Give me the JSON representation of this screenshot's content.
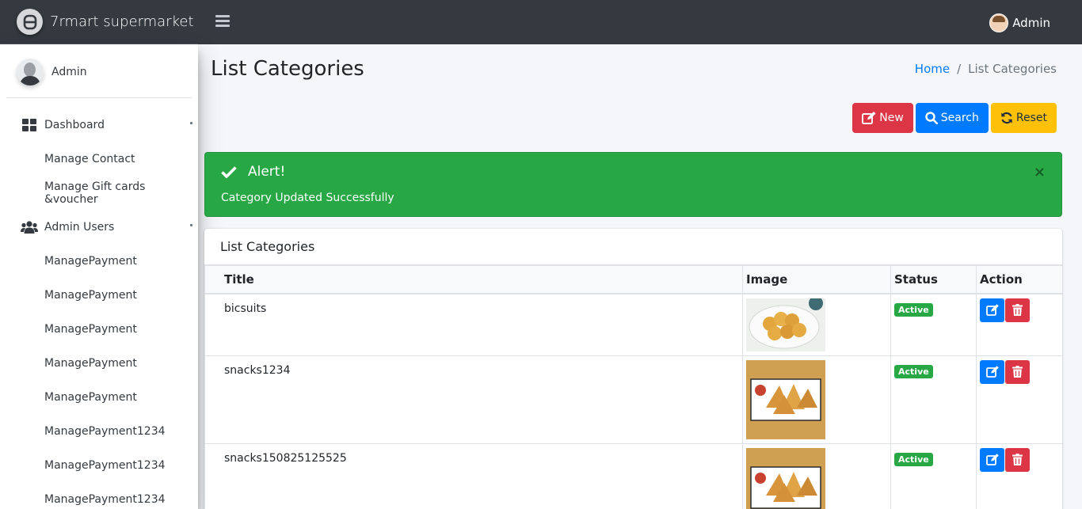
{
  "app": {
    "brand": "7rmart supermarket"
  },
  "topbar": {
    "user_name": "Admin"
  },
  "sidebar": {
    "user_name": "Admin",
    "items": [
      {
        "label": "Dashboard",
        "icon": "dashboard-grid-icon",
        "type": "parent"
      },
      {
        "label": "Manage Contact",
        "type": "child"
      },
      {
        "label": "Manage Gift cards &voucher",
        "type": "child"
      },
      {
        "label": "Admin Users",
        "icon": "users-icon",
        "type": "parent"
      },
      {
        "label": "ManagePayment",
        "type": "child"
      },
      {
        "label": "ManagePayment",
        "type": "child"
      },
      {
        "label": "ManagePayment",
        "type": "child"
      },
      {
        "label": "ManagePayment",
        "type": "child"
      },
      {
        "label": "ManagePayment",
        "type": "child"
      },
      {
        "label": "ManagePayment1234",
        "type": "child"
      },
      {
        "label": "ManagePayment1234",
        "type": "child"
      },
      {
        "label": "ManagePayment1234",
        "type": "child"
      }
    ]
  },
  "page": {
    "title": "List Categories",
    "breadcrumb": {
      "home": "Home",
      "current": "List Categories"
    }
  },
  "toolbar": {
    "new_label": "New",
    "search_label": "Search",
    "reset_label": "Reset"
  },
  "alert": {
    "title": "Alert!",
    "message": "Category Updated Successfully",
    "close": "×"
  },
  "table": {
    "card_title": "List Categories",
    "columns": [
      "Title",
      "Image",
      "Status",
      "Action"
    ],
    "rows": [
      {
        "title": "bicsuits",
        "image": "biscuits-plate",
        "status": "Active"
      },
      {
        "title": "snacks1234",
        "image": "samosa-plate",
        "status": "Active"
      },
      {
        "title": "snacks150825125525",
        "image": "samosa-plate",
        "status": "Active"
      }
    ]
  },
  "colors": {
    "navbar": "#343a40",
    "alert_success": "#28a745",
    "btn_new": "#dc3545",
    "btn_search": "#007bff",
    "btn_reset": "#ffc107",
    "link": "#007bff"
  }
}
